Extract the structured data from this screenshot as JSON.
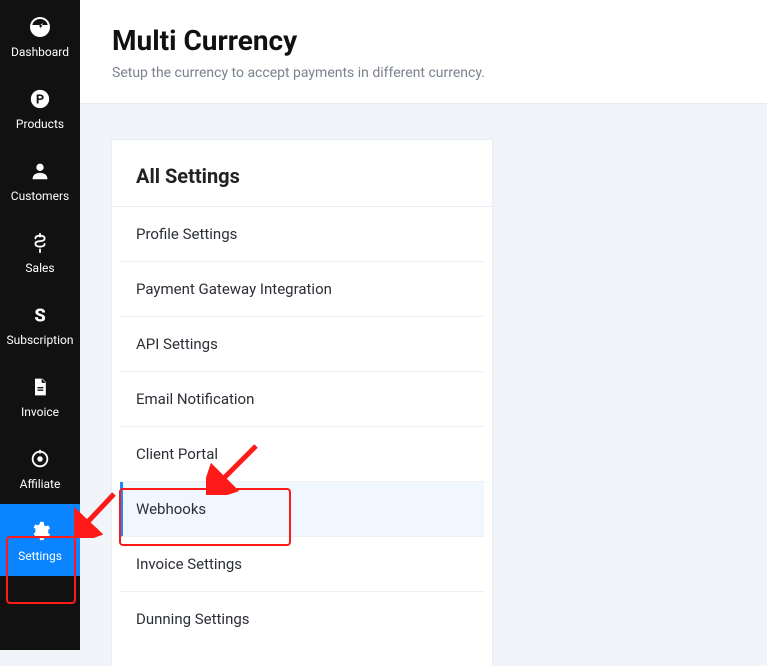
{
  "sidebar": {
    "items": [
      {
        "label": "Dashboard",
        "icon": "dashboard-icon",
        "active": false
      },
      {
        "label": "Products",
        "icon": "products-icon",
        "active": false
      },
      {
        "label": "Customers",
        "icon": "customers-icon",
        "active": false
      },
      {
        "label": "Sales",
        "icon": "sales-icon",
        "active": false
      },
      {
        "label": "Subscription",
        "icon": "subscription-icon",
        "active": false
      },
      {
        "label": "Invoice",
        "icon": "invoice-icon",
        "active": false
      },
      {
        "label": "Affiliate",
        "icon": "affiliate-icon",
        "active": false
      },
      {
        "label": "Settings",
        "icon": "gear-icon",
        "active": true
      }
    ]
  },
  "header": {
    "title": "Multi Currency",
    "subtitle": "Setup the currency to accept payments in different currency."
  },
  "panel": {
    "title": "All Settings",
    "items": [
      {
        "label": "Profile Settings",
        "selected": false
      },
      {
        "label": "Payment Gateway Integration",
        "selected": false
      },
      {
        "label": "API Settings",
        "selected": false
      },
      {
        "label": "Email Notification",
        "selected": false
      },
      {
        "label": "Client Portal",
        "selected": false
      },
      {
        "label": "Webhooks",
        "selected": true
      },
      {
        "label": "Invoice Settings",
        "selected": false
      },
      {
        "label": "Dunning Settings",
        "selected": false
      }
    ]
  },
  "annotations": {
    "highlight_sidebar": "Settings",
    "highlight_panel_item": "Webhooks",
    "arrow_color": "#ff1a1a"
  }
}
